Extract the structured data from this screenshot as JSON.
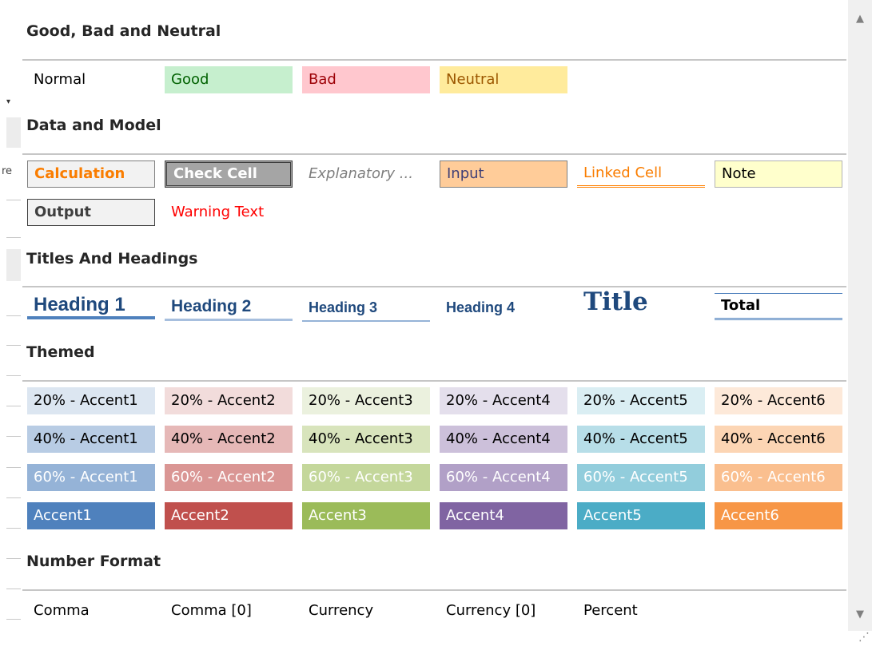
{
  "left_fragments": {
    "re": "re"
  },
  "sections": {
    "good_bad_neutral": {
      "title": "Good, Bad and Neutral",
      "styles": [
        "Normal",
        "Good",
        "Bad",
        "Neutral"
      ]
    },
    "data_model": {
      "title": "Data and Model",
      "row1": [
        "Calculation",
        "Check Cell",
        "Explanatory ...",
        "Input",
        "Linked Cell",
        "Note"
      ],
      "row2": [
        "Output",
        "Warning Text"
      ]
    },
    "titles_headings": {
      "title": "Titles And Headings",
      "styles": [
        "Heading 1",
        "Heading 2",
        "Heading 3",
        "Heading 4",
        "Title",
        "Total"
      ]
    },
    "themed": {
      "title": "Themed",
      "row20": [
        "20% - Accent1",
        "20% - Accent2",
        "20% - Accent3",
        "20% - Accent4",
        "20% - Accent5",
        "20% - Accent6"
      ],
      "row40": [
        "40% - Accent1",
        "40% - Accent2",
        "40% - Accent3",
        "40% - Accent4",
        "40% - Accent5",
        "40% - Accent6"
      ],
      "row60": [
        "60% - Accent1",
        "60% - Accent2",
        "60% - Accent3",
        "60% - Accent4",
        "60% - Accent5",
        "60% - Accent6"
      ],
      "row100": [
        "Accent1",
        "Accent2",
        "Accent3",
        "Accent4",
        "Accent5",
        "Accent6"
      ]
    },
    "number_format": {
      "title": "Number Format",
      "styles": [
        "Comma",
        "Comma [0]",
        "Currency",
        "Currency [0]",
        "Percent"
      ]
    }
  },
  "icons": {
    "scroll_up": "scroll-up-arrow-icon",
    "scroll_down": "scroll-down-arrow-icon",
    "resize": "resize-grip-icon"
  },
  "colors": {
    "accent1": "#4f81bd",
    "accent2": "#c0504d",
    "accent3": "#9bbb59",
    "accent4": "#8064a2",
    "accent5": "#4bacc6",
    "accent6": "#f79646",
    "good_fill": "#c6efce",
    "bad_fill": "#ffc7ce",
    "neutral_fill": "#ffeb9c"
  }
}
